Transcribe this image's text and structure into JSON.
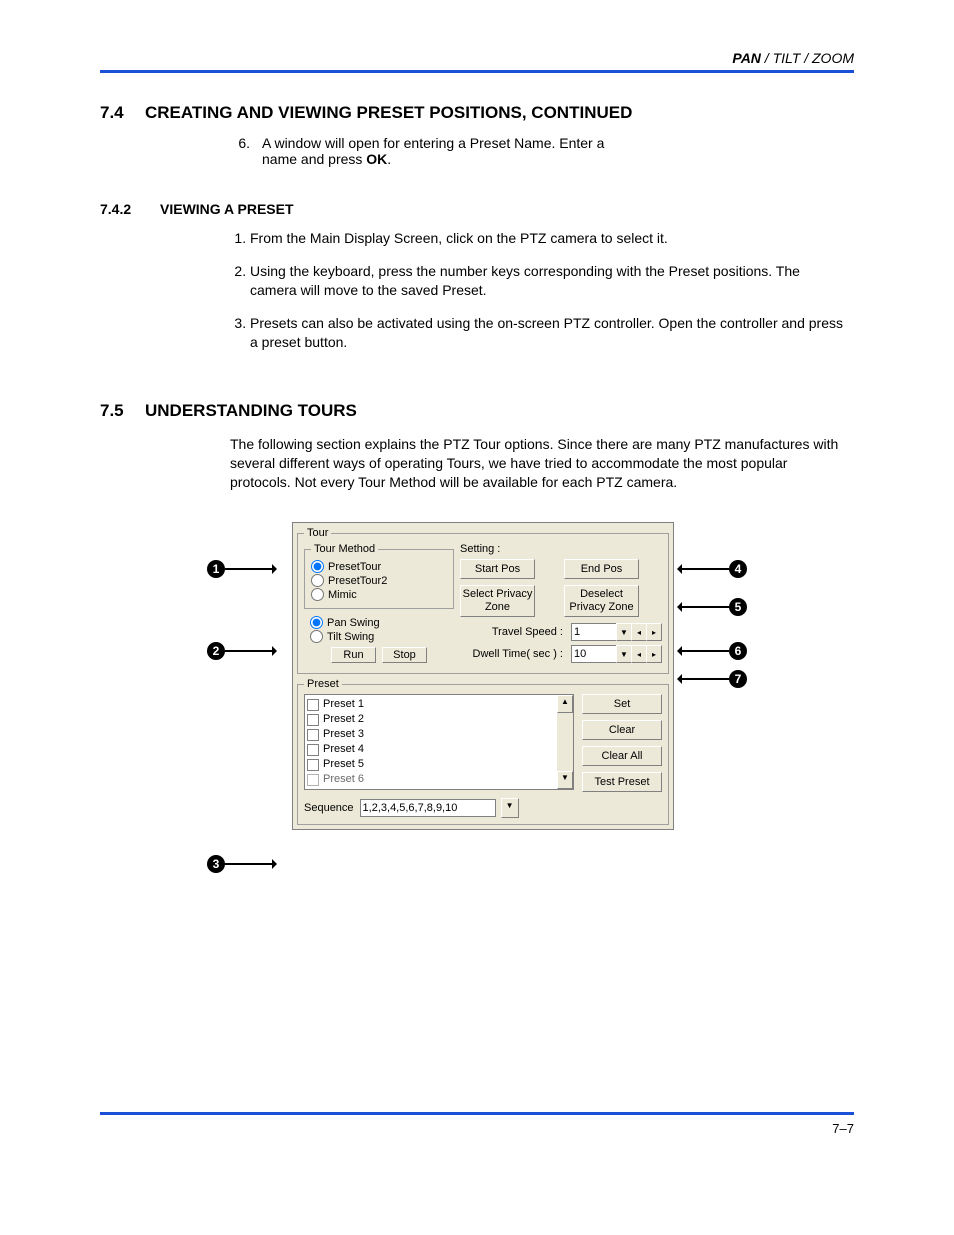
{
  "header": {
    "label_pan": "PAN",
    "label_rest": " / TILT / ZOOM"
  },
  "section_7_4": {
    "number": "7.4",
    "title": "CREATING AND VIEWING PRESET POSITIONS, CONTINUED",
    "step6_num": "6.",
    "step6_a": "A window will open for entering a Preset Name. Enter a name and press ",
    "step6_b": "OK",
    "step6_c": "."
  },
  "section_7_4_2": {
    "number": "7.4.2",
    "title": "VIEWING A PRESET",
    "steps": [
      "From the Main Display Screen, click on the PTZ camera to select it.",
      "Using the keyboard, press the number keys corresponding with the Preset positions. The camera will move to the saved Preset.",
      "Presets can also be activated using the on-screen PTZ controller. Open the controller and press a preset button."
    ]
  },
  "section_7_5": {
    "number": "7.5",
    "title": "UNDERSTANDING TOURS",
    "para": "The following section explains the PTZ Tour options. Since there are many PTZ manufactures with several different ways of operating Tours, we have tried to accommodate the most popular protocols. Not every Tour Method will be available for each PTZ camera."
  },
  "dialog": {
    "tour_legend": "Tour",
    "tourmethod_legend": "Tour Method",
    "radios": {
      "presettour": "PresetTour",
      "presettour2": "PresetTour2",
      "mimic": "Mimic",
      "panswing": "Pan Swing",
      "tiltswing": "Tilt Swing"
    },
    "run": "Run",
    "stop": "Stop",
    "setting_label": "Setting  :",
    "start_pos": "Start Pos",
    "end_pos": "End Pos",
    "select_priv": "Select Privacy Zone",
    "deselect_priv": "Deselect Privacy Zone",
    "travel_speed_label": "Travel Speed  :",
    "travel_speed_value": "1",
    "dwell_label": "Dwell Time( sec )  :",
    "dwell_value": "10",
    "preset_legend": "Preset",
    "preset_items": [
      "Preset 1",
      "Preset 2",
      "Preset 3",
      "Preset 4",
      "Preset 5",
      "Preset 6"
    ],
    "set": "Set",
    "clear": "Clear",
    "clear_all": "Clear All",
    "test_preset": "Test Preset",
    "sequence_label": "Sequence",
    "sequence_value": "1,2,3,4,5,6,7,8,9,10"
  },
  "callouts": {
    "c1": "1",
    "c2": "2",
    "c3": "3",
    "c4": "4",
    "c5": "5",
    "c6": "6",
    "c7": "7"
  },
  "page_number": "7–7"
}
